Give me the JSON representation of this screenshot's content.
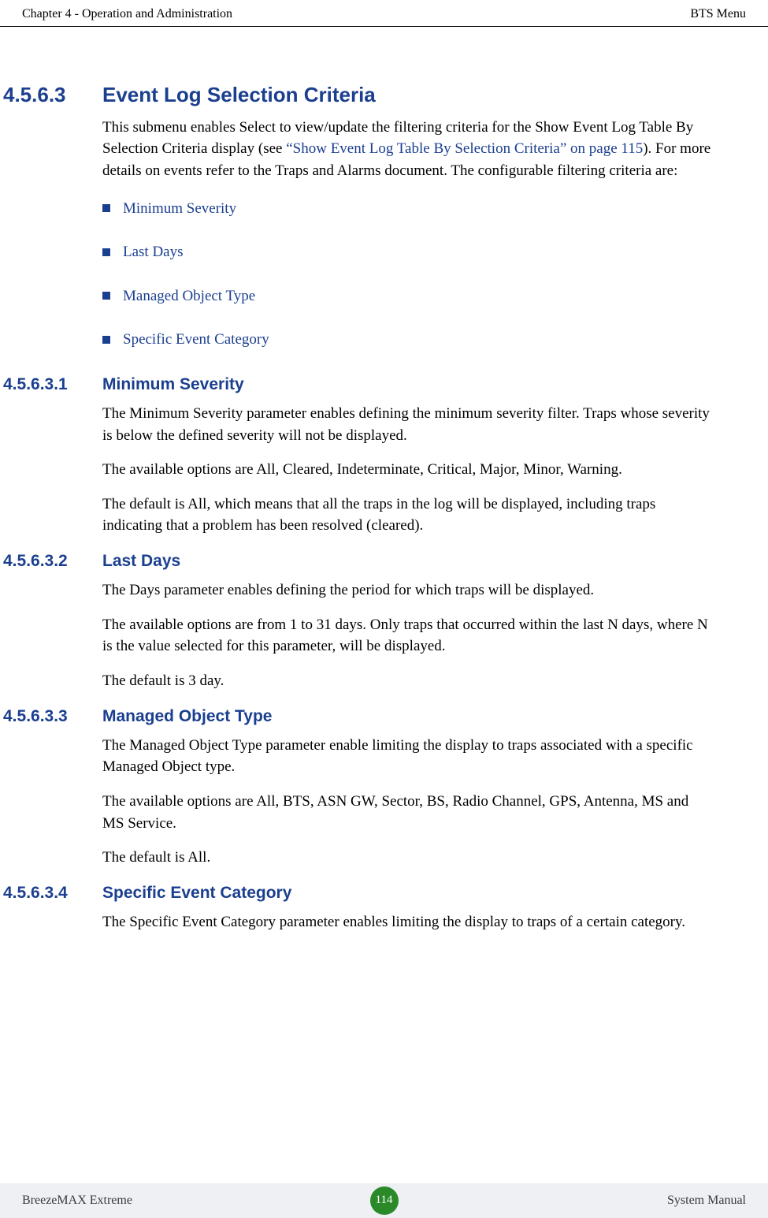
{
  "header": {
    "left": "Chapter 4 - Operation and Administration",
    "right": "BTS Menu"
  },
  "s1": {
    "num": "4.5.6.3",
    "title": "Event Log Selection Criteria",
    "intro_before": "This submenu enables Select to view/update the filtering criteria for the Show Event Log Table By Selection Criteria display (see ",
    "intro_xref": "“Show Event Log Table By Selection Criteria” on page 115",
    "intro_after": "). For more details on events refer to the Traps and Alarms document. The configurable filtering criteria are:",
    "bullets": {
      "0": "Minimum Severity",
      "1": "Last Days",
      "2": "Managed Object Type",
      "3": "Specific Event Category"
    }
  },
  "s1_1": {
    "num": "4.5.6.3.1",
    "title": "Minimum Severity",
    "p1": "The Minimum Severity parameter enables defining the minimum severity filter. Traps whose severity is below the defined severity will not be displayed.",
    "p2": "The available options are All, Cleared, Indeterminate, Critical, Major, Minor, Warning.",
    "p3": "The default is All, which means that all the traps in the log will be displayed, including traps indicating that a problem has been resolved (cleared)."
  },
  "s1_2": {
    "num": "4.5.6.3.2",
    "title": "Last Days",
    "p1": "The Days parameter enables defining the period for which traps will be displayed.",
    "p2": "The available options are from 1 to 31 days. Only traps that occurred within the last N days, where N is the value selected for this parameter, will be displayed.",
    "p3": "The default is 3 day."
  },
  "s1_3": {
    "num": "4.5.6.3.3",
    "title": "Managed Object Type",
    "p1": "The Managed Object Type parameter enable limiting the display to traps associated with a specific Managed Object type.",
    "p2": "The available options are All, BTS, ASN GW, Sector, BS, Radio Channel, GPS, Antenna, MS and MS Service.",
    "p3": "The default is All."
  },
  "s1_4": {
    "num": "4.5.6.3.4",
    "title": "Specific Event Category",
    "p1": "The Specific Event Category parameter enables limiting the display to traps of a certain category."
  },
  "footer": {
    "left": "BreezeMAX Extreme",
    "page": "114",
    "right": "System Manual"
  }
}
